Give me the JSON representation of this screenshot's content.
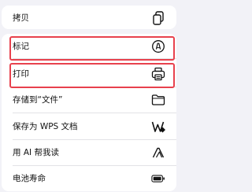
{
  "menu": {
    "items": [
      {
        "label": "拷贝",
        "icon": "copy-icon"
      },
      {
        "label": "标记",
        "icon": "markup-icon",
        "highlighted": true
      },
      {
        "label": "打印",
        "icon": "print-icon",
        "highlighted": true
      },
      {
        "label": "存储到“文件”",
        "icon": "folder-icon"
      },
      {
        "label": "保存为 WPS 文档",
        "icon": "wps-icon"
      },
      {
        "label": "用 AI 帮我读",
        "icon": "ai-read-icon"
      },
      {
        "label": "电池寿命",
        "icon": "battery-icon"
      }
    ]
  },
  "colors": {
    "highlight": "#e8414d",
    "background": "#f2f2f7",
    "card": "#ffffff",
    "text": "#111111"
  }
}
